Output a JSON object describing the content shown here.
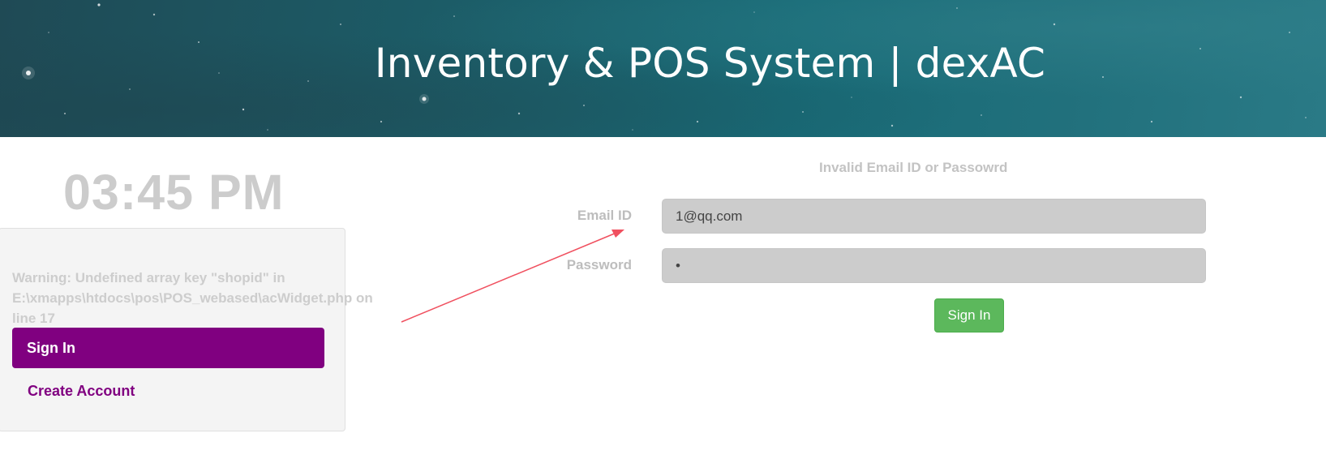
{
  "header": {
    "title": "Inventory & POS System | dexAC"
  },
  "clock": {
    "time": "03:45 PM"
  },
  "widget": {
    "warning_text": "Warning: Undefined array key \"shopid\" in E:\\xmapps\\htdocs\\pos\\POS_webased\\acWidget.php on line 17",
    "signin_label": "Sign In",
    "create_account_label": "Create Account"
  },
  "login_form": {
    "error_message": "Invalid Email ID or Passowrd",
    "email_label": "Email ID",
    "email_value": "1@qq.com",
    "password_label": "Password",
    "password_value": "•",
    "submit_label": "Sign In"
  },
  "colors": {
    "widget_accent": "#800080",
    "submit_button": "#5cb85c",
    "banner": "#1c5d68",
    "annotation_arrow": "#f0505f"
  }
}
